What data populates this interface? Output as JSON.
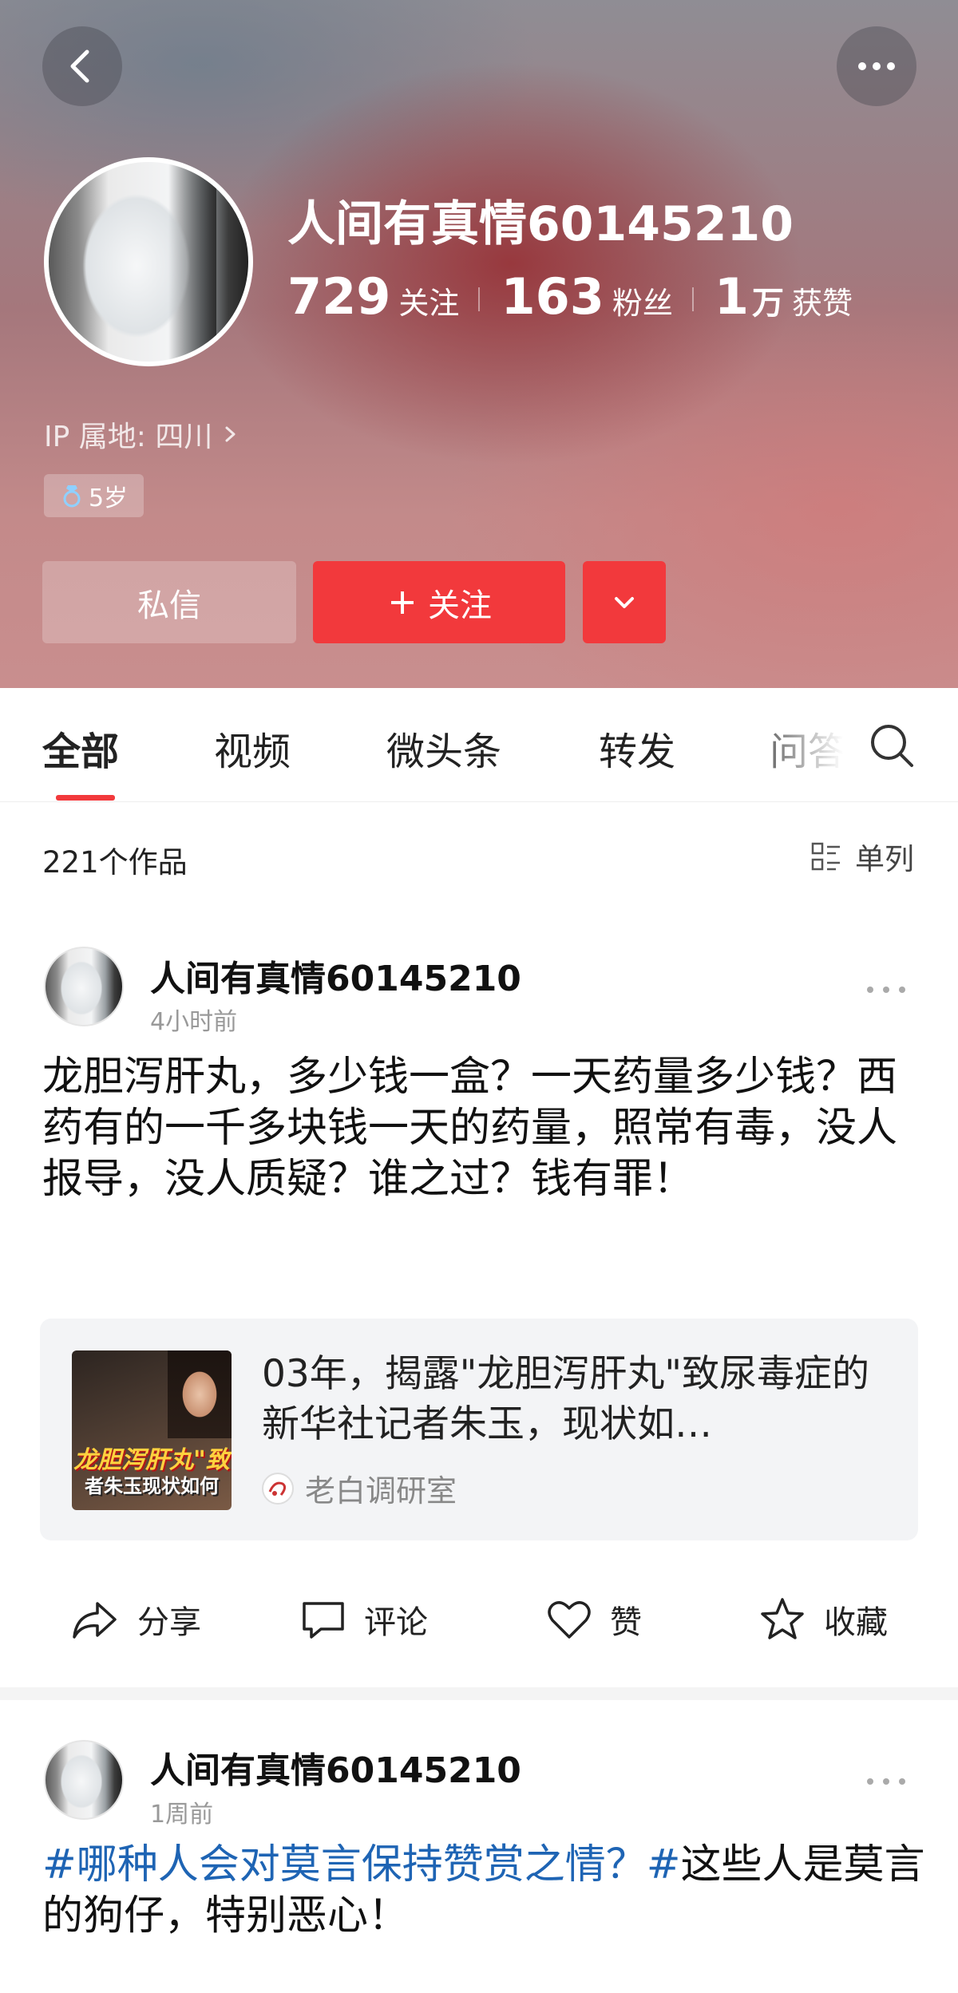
{
  "profile": {
    "username": "人间有真情60145210",
    "stats": [
      {
        "num": "729",
        "unit": "",
        "label": "关注"
      },
      {
        "num": "163",
        "unit": "",
        "label": "粉丝"
      },
      {
        "num": "1",
        "unit": "万",
        "label": "获赞"
      }
    ],
    "ip_location": "IP 属地: 四川",
    "age_badge": "5岁",
    "buttons": {
      "message": "私信",
      "follow": "关注"
    }
  },
  "tabs": [
    "全部",
    "视频",
    "微头条",
    "转发",
    "问答"
  ],
  "works_count": "221个作品",
  "view_mode": "单列",
  "posts": [
    {
      "author": "人间有真情60145210",
      "time": "4小时前",
      "text": "龙胆泻肝丸，多少钱一盒？一天药量多少钱？西药有的一千多块钱一天的药量，照常有毒，没人报导，没人质疑？谁之过？钱有罪！",
      "card": {
        "title": "03年，揭露\"龙胆泻肝丸\"致尿毒症的新华社记者朱玉，现状如…",
        "source": "老白调研室",
        "thumb_line1": "龙胆泻肝丸\"致",
        "thumb_line2": "者朱玉现状如何"
      },
      "actions": [
        "分享",
        "评论",
        "赞",
        "收藏"
      ]
    },
    {
      "author": "人间有真情60145210",
      "time": "1周前",
      "hashtag1": "#哪种人会对莫言保持赞赏之情？#",
      "text_rest": "这些人是莫言的狗仔，特别恶心！"
    }
  ],
  "colors": {
    "accent": "#f2393c",
    "hashtag": "#1e64b4"
  }
}
